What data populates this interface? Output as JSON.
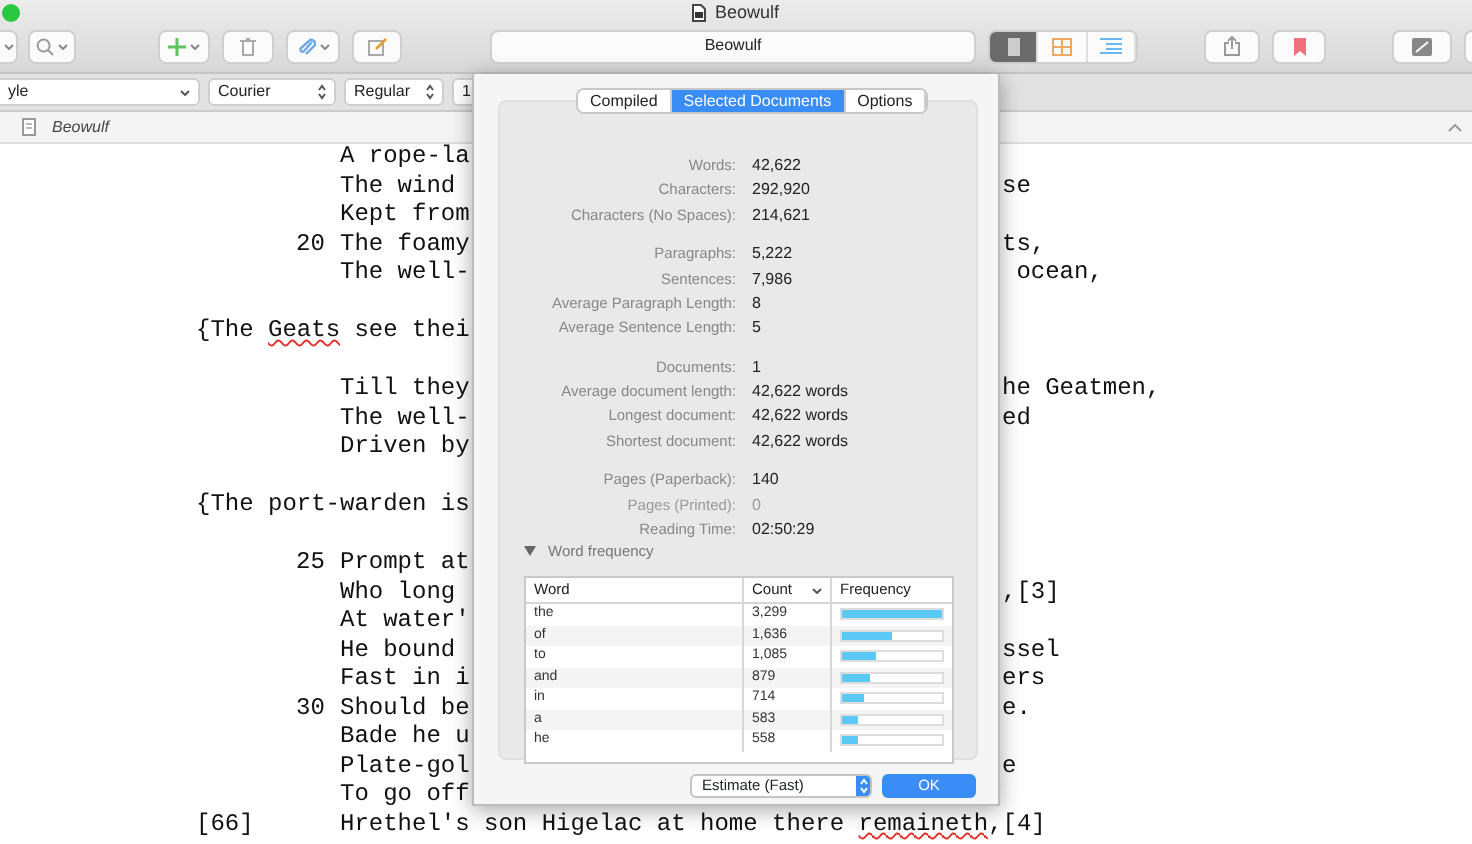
{
  "window": {
    "title": "Beowulf"
  },
  "toolbar": {
    "path_field": "Beowulf",
    "view_modes": [
      {
        "kind": "single",
        "selected": true
      },
      {
        "kind": "grid",
        "selected": false
      },
      {
        "kind": "outline",
        "selected": false
      }
    ]
  },
  "format_bar": {
    "style": "yle",
    "font": "Courier",
    "weight": "Regular",
    "size": "1"
  },
  "editor": {
    "header_title": "Beowulf",
    "lines": [
      {
        "kind": "verse",
        "left": "A rope-la"
      },
      {
        "kind": "verse",
        "left": "The wind ",
        "right": "se"
      },
      {
        "kind": "verse",
        "left": "Kept from"
      },
      {
        "kind": "numbered",
        "number": "20",
        "left": "The foamy",
        "right": "ts,"
      },
      {
        "kind": "verse",
        "left": "The well-",
        "right": " ocean,"
      },
      {
        "kind": "blank"
      },
      {
        "kind": "note",
        "segments": [
          {
            "text": "{The "
          },
          {
            "text": "Geats",
            "misspelled": true
          },
          {
            "text": " see thei"
          }
        ]
      },
      {
        "kind": "blank"
      },
      {
        "kind": "verse",
        "left": "Till they",
        "right": "he Geatmen,"
      },
      {
        "kind": "verse",
        "left": "The well-",
        "right": "ed"
      },
      {
        "kind": "verse",
        "left": "Driven by"
      },
      {
        "kind": "blank"
      },
      {
        "kind": "note",
        "left": "{The port-warden is"
      },
      {
        "kind": "blank"
      },
      {
        "kind": "numbered",
        "number": "25",
        "left": "Prompt at"
      },
      {
        "kind": "verse",
        "left": "Who long",
        "right": ",[3]"
      },
      {
        "kind": "verse",
        "left": "At water'"
      },
      {
        "kind": "verse",
        "left": "He bound",
        "right": "ssel"
      },
      {
        "kind": "verse",
        "left": "Fast in i",
        "right": "ers"
      },
      {
        "kind": "numbered",
        "number": "30",
        "left": "Should be",
        "right": "e."
      },
      {
        "kind": "verse",
        "left": "Bade he u"
      },
      {
        "kind": "verse",
        "left": "Plate-gol",
        "right": "e"
      },
      {
        "kind": "verse",
        "left": "To go off"
      },
      {
        "kind": "marker",
        "marker": "[66]",
        "segments": [
          {
            "text": "Hrethel's son Higelac at home there "
          },
          {
            "text": "remaineth",
            "misspelled": true
          },
          {
            "text": ",[4]"
          }
        ]
      }
    ]
  },
  "dialog": {
    "tabs": [
      {
        "label": "Compiled",
        "selected": false
      },
      {
        "label": "Selected Documents",
        "selected": true
      },
      {
        "label": "Options",
        "selected": false
      }
    ],
    "stat_groups": [
      [
        {
          "label": "Words:",
          "value": "42,622",
          "disabled": false
        },
        {
          "label": "Characters:",
          "value": "292,920",
          "disabled": false
        },
        {
          "label": "Characters (No Spaces):",
          "value": "214,621",
          "disabled": false
        }
      ],
      [
        {
          "label": "Paragraphs:",
          "value": "5,222",
          "disabled": false
        },
        {
          "label": "Sentences:",
          "value": "7,986",
          "disabled": false
        },
        {
          "label": "Average Paragraph Length:",
          "value": "8",
          "disabled": false
        },
        {
          "label": "Average Sentence Length:",
          "value": "5",
          "disabled": false
        }
      ],
      [
        {
          "label": "Documents:",
          "value": "1",
          "disabled": false
        },
        {
          "label": "Average document length:",
          "value": "42,622 words",
          "disabled": false
        },
        {
          "label": "Longest document:",
          "value": "42,622 words",
          "disabled": false
        },
        {
          "label": "Shortest document:",
          "value": "42,622 words",
          "disabled": false
        }
      ],
      [
        {
          "label": "Pages (Paperback):",
          "value": "140",
          "disabled": false
        },
        {
          "label": "Pages (Printed):",
          "value": "0",
          "disabled": true
        },
        {
          "label": "Reading Time:",
          "value": "02:50:29",
          "disabled": false
        }
      ]
    ],
    "word_frequency": {
      "label": "Word frequency",
      "expanded": true,
      "columns": [
        "Word",
        "Count",
        "Frequency"
      ],
      "rows": [
        {
          "word": "the",
          "count": "3,299",
          "level": 1.0
        },
        {
          "word": "of",
          "count": "1,636",
          "level": 0.5
        },
        {
          "word": "to",
          "count": "1,085",
          "level": 0.33
        },
        {
          "word": "and",
          "count": "879",
          "level": 0.27
        },
        {
          "word": "in",
          "count": "714",
          "level": 0.22
        },
        {
          "word": "a",
          "count": "583",
          "level": 0.16
        },
        {
          "word": "he",
          "count": "558",
          "level": 0.16
        }
      ]
    },
    "method": "Estimate (Fast)",
    "ok": "OK"
  }
}
